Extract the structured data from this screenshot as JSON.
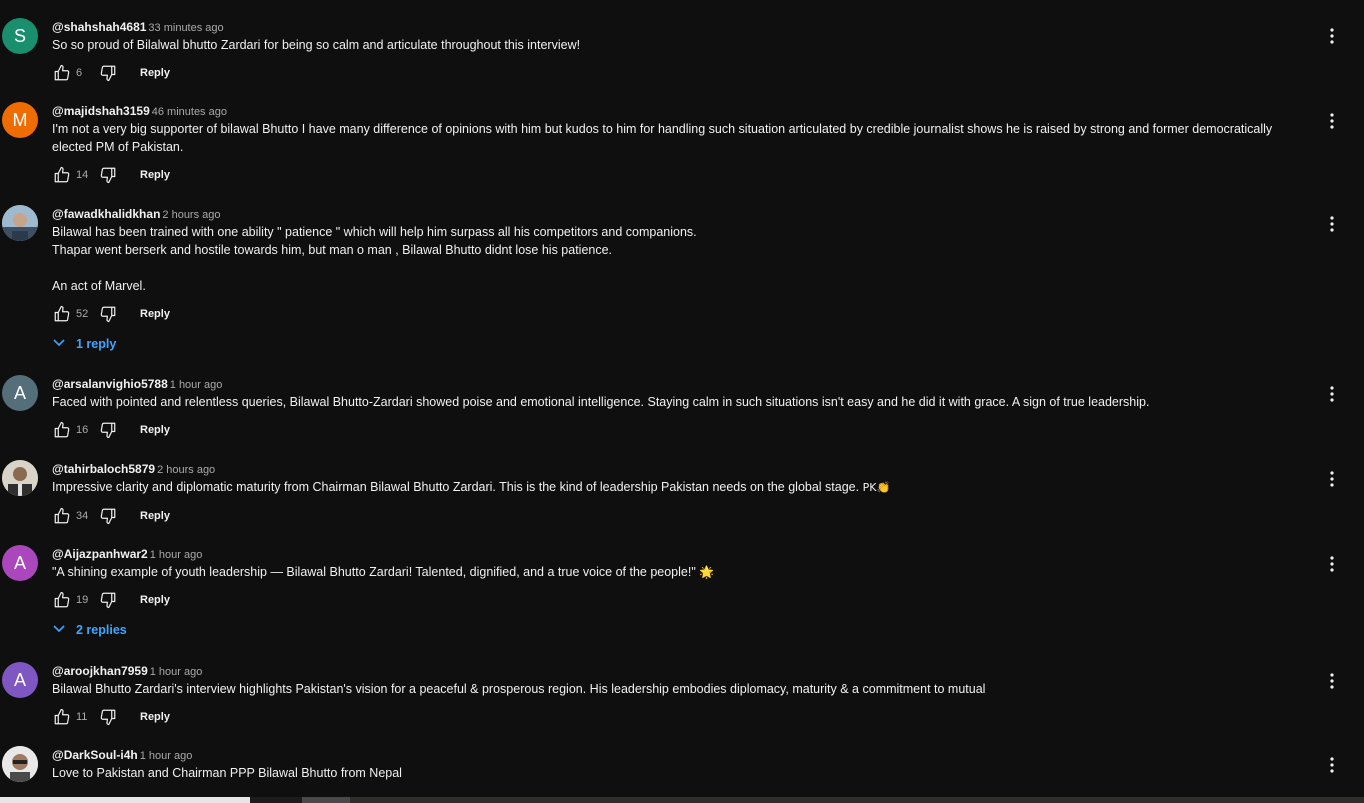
{
  "ui": {
    "reply_label": "Reply",
    "colors": {
      "background": "#0f0f0f",
      "text_primary": "#f1f1f1",
      "text_secondary": "#aaaaaa",
      "link_blue": "#3ea6ff"
    }
  },
  "comments": [
    {
      "avatar_letter": "S",
      "avatar_color": "#1a8f6e",
      "handle": "@shahshah4681",
      "time": "33 minutes ago",
      "text": "So so proud of Bilalwal bhutto Zardari for being so calm and articulate throughout this interview!",
      "likes": "6"
    },
    {
      "avatar_letter": "M",
      "avatar_color": "#ef6c00",
      "handle": "@majidshah3159",
      "time": "46 minutes ago",
      "text": "I'm not a very big supporter of bilawal Bhutto I have many difference of opinions with him but kudos to him for handling such situation articulated by credible journalist shows he is raised by strong and former democratically elected PM of Pakistan.",
      "likes": "14"
    },
    {
      "avatar_letter": "",
      "avatar_color": "#7a9cb8",
      "handle": "@fawadkhalidkhan",
      "time": "2 hours ago",
      "text": "Bilawal has been trained with one ability \" patience \" which will help him surpass all his competitors and companions.\nThapar went berserk and hostile towards him, but man o man , Bilawal Bhutto didnt lose his patience.\n\nAn act of Marvel.",
      "likes": "52",
      "replies": "1 reply"
    },
    {
      "avatar_letter": "A",
      "avatar_color": "#546e7a",
      "handle": "@arsalanvighio5788",
      "time": "1 hour ago",
      "text": "Faced with pointed and relentless queries, Bilawal Bhutto-Zardari showed poise and emotional intelligence. Staying calm in such situations isn't easy and he did it with grace. A sign of true leadership.",
      "likes": "16"
    },
    {
      "avatar_letter": "",
      "avatar_color": "#8d8d7a",
      "handle": "@tahirbaloch5879",
      "time": "2 hours ago",
      "text": "Impressive clarity and diplomatic maturity from Chairman Bilawal Bhutto Zardari. This is the kind of leadership Pakistan needs on the global stage.",
      "emoji": "PK👏",
      "likes": "34"
    },
    {
      "avatar_letter": "A",
      "avatar_color": "#ab47bc",
      "handle": "@Aijazpanhwar2",
      "time": "1 hour ago",
      "text": "\"A shining example of youth leadership — Bilawal Bhutto Zardari! Talented, dignified, and a true voice of the people!\"",
      "emoji": "🌟",
      "likes": "19",
      "replies": "2 replies"
    },
    {
      "avatar_letter": "A",
      "avatar_color": "#7e57c2",
      "handle": "@aroojkhan7959",
      "time": "1 hour ago",
      "text": "Bilawal Bhutto Zardari's interview highlights Pakistan's vision for a peaceful & prosperous region. His leadership embodies diplomacy, maturity & a commitment to mutual",
      "likes": "11"
    },
    {
      "avatar_letter": "",
      "avatar_color": "#d9d9d9",
      "handle": "@DarkSoul-i4h",
      "time": "1 hour ago",
      "text": "Love to Pakistan and Chairman PPP Bilawal Bhutto from Nepal",
      "likes": ""
    }
  ]
}
